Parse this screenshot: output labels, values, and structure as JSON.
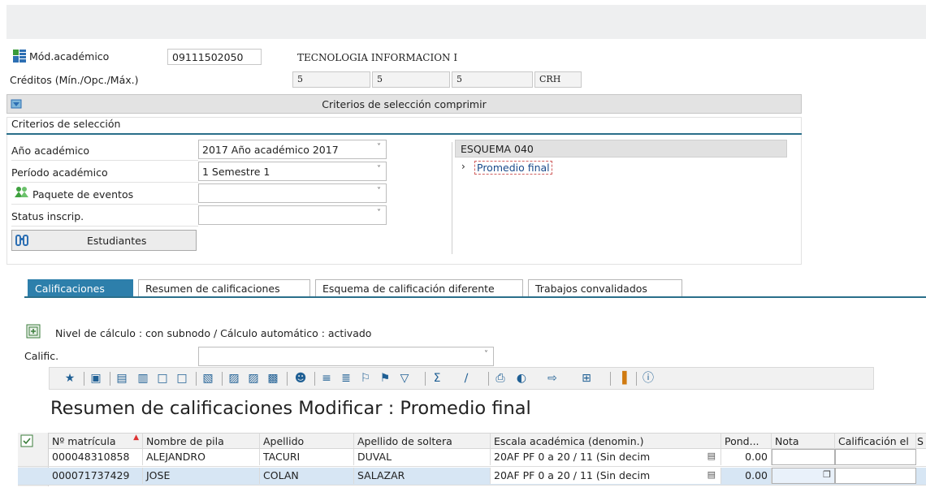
{
  "header": {
    "mod_label": "Mód.académico",
    "mod_code": "09111502050",
    "mod_name": "TECNOLOGIA INFORMACION I",
    "credits_label": "Créditos (Mín./Opc./Máx.)",
    "credits": [
      "5",
      "5",
      "5"
    ],
    "credits_unit": "CRH"
  },
  "panel": {
    "title": "Criterios de selección comprimir",
    "section_title": "Criterios de selección",
    "rows": [
      {
        "label": "Año académico",
        "value": "2017 Año académico 2017"
      },
      {
        "label": "Período académico",
        "value": "1 Semestre 1"
      },
      {
        "label": "Paquete de eventos",
        "value": ""
      },
      {
        "label": "Status inscrip.",
        "value": ""
      }
    ],
    "students_button": "Estudiantes",
    "schema_title": "ESQUEMA 040",
    "schema_item": "Promedio final"
  },
  "tabs": [
    "Calificaciones",
    "Resumen de calificaciones",
    "Esquema de calificación diferente",
    "Trabajos convalidados"
  ],
  "calc_level": "Nivel de cálculo : con subnodo / Cálculo automático : activado",
  "calific_label": "Calific.",
  "calific_value": "",
  "grid": {
    "title": "Resumen de calificaciones Modificar : Promedio final",
    "columns": [
      "Nº matrícula",
      "Nombre de pila",
      "Apellido",
      "Apellido de soltera",
      "Escala académica (denomin.)",
      "Pond...",
      "Nota",
      "Calificación el",
      "S"
    ],
    "rows": [
      {
        "matricula": "000048310858",
        "nombre": "ALEJANDRO",
        "apellido": "TACURI",
        "soltera": "DUVAL",
        "escala": "20AF PF 0 a 20 / 11 (Sin decim",
        "pond": "0.00",
        "nota": "",
        "calif": ""
      },
      {
        "matricula": "000071737429",
        "nombre": "JOSE",
        "apellido": "COLAN",
        "soltera": "SALAZAR",
        "escala": "20AF PF 0 a 20 / 11 (Sin decim",
        "pond": "0.00",
        "nota": "",
        "calif": ""
      }
    ]
  },
  "colors": {
    "accent": "#2a6f8a",
    "tab_active": "#2d7fab",
    "row_selected": "#d7e6f4"
  }
}
